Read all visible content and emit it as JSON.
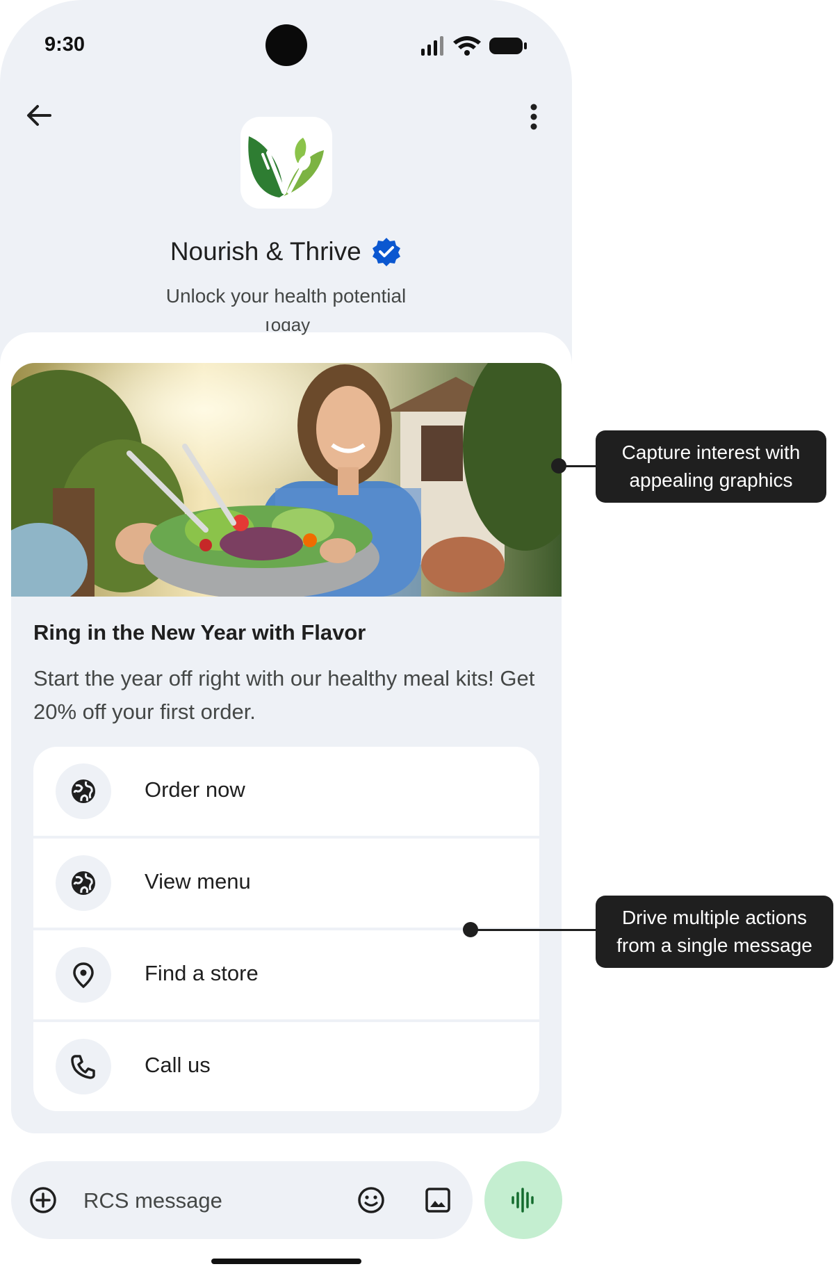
{
  "status_bar": {
    "time": "9:30"
  },
  "header": {
    "brand_name": "Nourish & Thrive",
    "tagline": "Unlock your health potential",
    "date_divider": "Today"
  },
  "card": {
    "image_description": "Woman holding a bowl of salad outdoors",
    "title": "Ring in the New Year with Flavor",
    "description": "Start the year off right with our healthy meal kits! Get 20% off your first order.",
    "actions": [
      {
        "label": "Order now",
        "icon": "globe-icon"
      },
      {
        "label": "View menu",
        "icon": "globe-icon"
      },
      {
        "label": "Find a store",
        "icon": "location-pin-icon"
      },
      {
        "label": "Call us",
        "icon": "phone-icon"
      }
    ]
  },
  "compose": {
    "placeholder": "RCS message"
  },
  "annotations": {
    "image_callout": "Capture interest with appealing graphics",
    "actions_callout": "Drive multiple actions from a single message"
  },
  "colors": {
    "screen_bg": "#eef1f6",
    "verified_badge": "#0b57d0",
    "voice_button": "#c4eed0",
    "voice_icon": "#146c2e",
    "callout_bg": "#1f1f1f"
  }
}
